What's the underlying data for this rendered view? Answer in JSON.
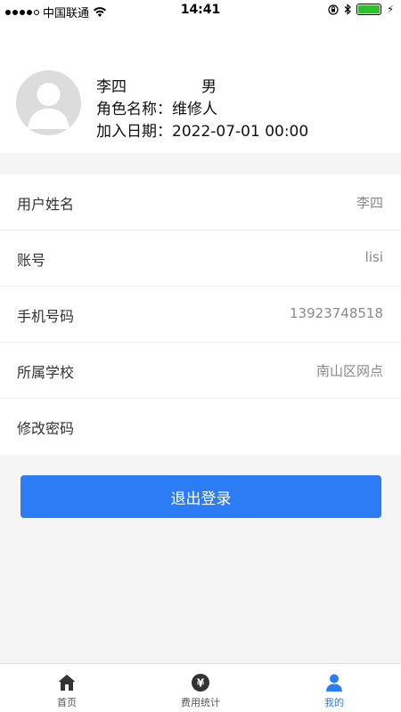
{
  "status_bar": {
    "carrier": "中国联通",
    "time": "14:41",
    "battery_level": 1.0
  },
  "profile": {
    "name": "李四",
    "gender": "男",
    "role": "角色名称：维修人",
    "join_date": "加入日期：2022-07-01 00:00"
  },
  "info": [
    {
      "label": "用户姓名",
      "value": "李四"
    },
    {
      "label": "账号",
      "value": "lisi"
    },
    {
      "label": "手机号码",
      "value": "13923748518"
    },
    {
      "label": "所属学校",
      "value": "南山区网点"
    },
    {
      "label": "修改密码",
      "value": ""
    }
  ],
  "logout_label": "退出登录",
  "tabs": [
    {
      "label": "首页",
      "icon": "home-icon"
    },
    {
      "label": "费用统计",
      "icon": "money-icon"
    },
    {
      "label": "我的",
      "icon": "person-icon"
    }
  ],
  "colors": {
    "accent": "#2c7cf6",
    "battery": "#2ec02e"
  }
}
